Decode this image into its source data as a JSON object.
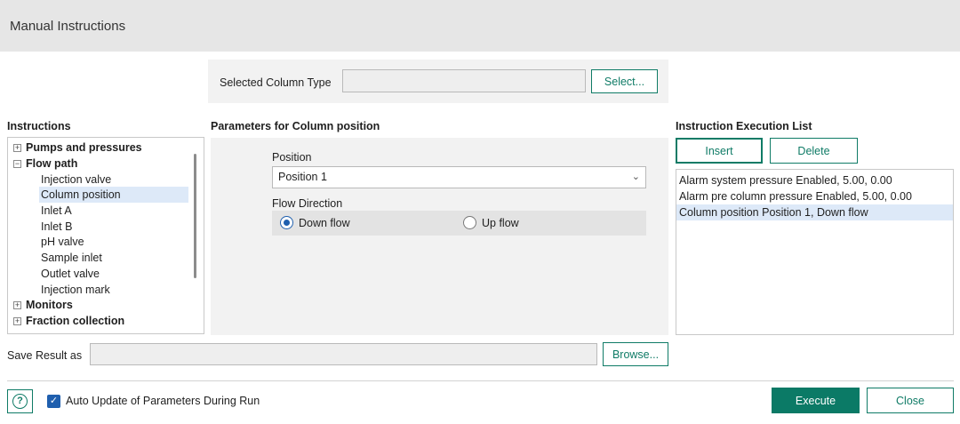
{
  "window": {
    "title": "Manual Instructions"
  },
  "column_type": {
    "label": "Selected Column Type",
    "value": "",
    "select_button": "Select..."
  },
  "instructions": {
    "heading": "Instructions",
    "groups": [
      {
        "label": "Pumps and pressures",
        "expanded": false
      },
      {
        "label": "Flow path",
        "expanded": true,
        "children": [
          "Injection valve",
          "Column position",
          "Inlet A",
          "Inlet B",
          "pH valve",
          "Sample inlet",
          "Outlet valve",
          "Injection mark"
        ],
        "selected_child": "Column position"
      },
      {
        "label": "Monitors",
        "expanded": false
      },
      {
        "label": "Fraction collection",
        "expanded": false
      }
    ]
  },
  "parameters": {
    "heading": "Parameters for Column position",
    "position_label": "Position",
    "position_value": "Position 1",
    "flow_direction_label": "Flow Direction",
    "options": [
      {
        "label": "Down flow",
        "selected": true
      },
      {
        "label": "Up flow",
        "selected": false
      }
    ]
  },
  "execution": {
    "heading": "Instruction Execution List",
    "insert_button": "Insert",
    "delete_button": "Delete",
    "items": [
      "Alarm system pressure Enabled, 5.00, 0.00",
      "Alarm pre column pressure Enabled, 5.00, 0.00",
      "Column position Position 1, Down flow"
    ],
    "selected_index": 2
  },
  "save_result": {
    "label": "Save Result as",
    "value": "",
    "browse_button": "Browse..."
  },
  "footer": {
    "help_icon": "question-icon",
    "auto_update_label": "Auto Update of Parameters During Run",
    "auto_update_checked": true,
    "execute_button": "Execute",
    "close_button": "Close"
  },
  "colors": {
    "accent": "#0b7a66",
    "selection": "#dde9f8",
    "radio": "#1f5fae"
  }
}
